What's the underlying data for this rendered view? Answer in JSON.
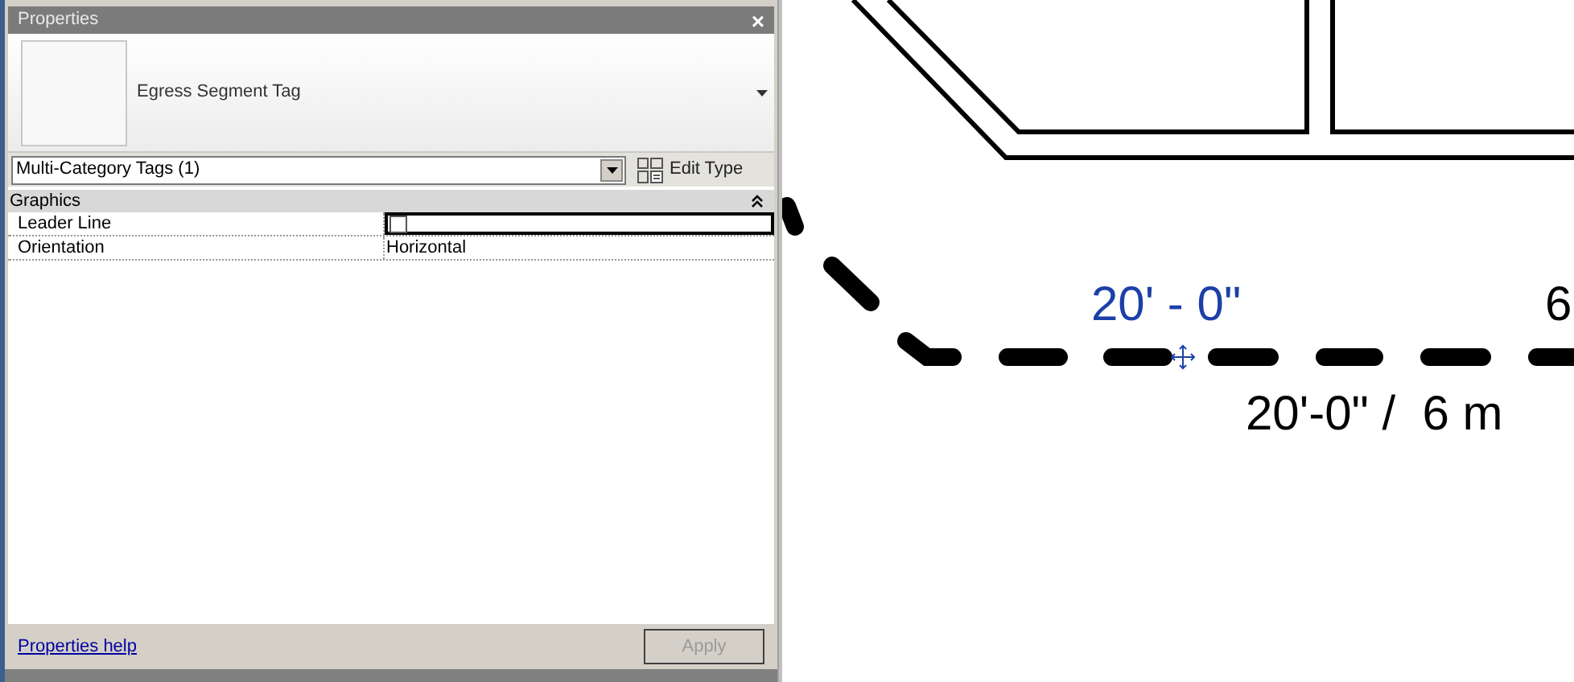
{
  "properties_panel": {
    "title": "Properties",
    "close_button": "×",
    "type_selector": {
      "name": "Egress Segment Tag"
    },
    "filter": {
      "value": "Multi-Category Tags (1)"
    },
    "edit_type_button": "Edit Type",
    "groups": [
      {
        "name": "Graphics",
        "expanded": true,
        "rows": [
          {
            "kind": "checkbox",
            "label": "Leader Line",
            "checked": false
          },
          {
            "kind": "text",
            "label": "Orientation",
            "value": "Horizontal"
          }
        ]
      }
    ],
    "help_link": "Properties help",
    "apply_button": {
      "label": "Apply",
      "disabled": true
    }
  },
  "canvas": {
    "labels": [
      {
        "kind": "selected_tag",
        "text": "20' - 0\""
      },
      {
        "kind": "tag",
        "text": "6"
      },
      {
        "kind": "tag",
        "text": "20'-0\" /  6 m"
      }
    ]
  }
}
